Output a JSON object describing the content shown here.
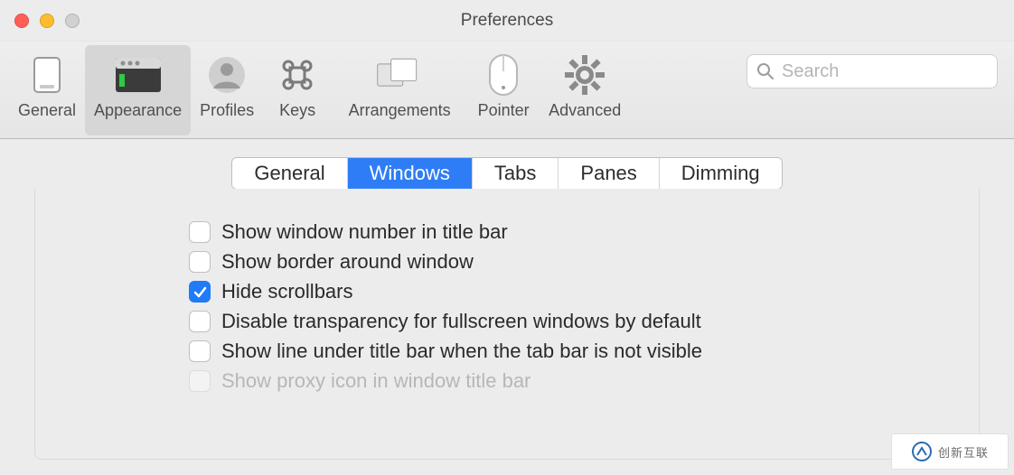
{
  "window": {
    "title": "Preferences"
  },
  "traffic": {
    "close": "close",
    "minimize": "minimize",
    "disabled": "zoom-disabled"
  },
  "toolbar": {
    "general": "General",
    "appearance": "Appearance",
    "profiles": "Profiles",
    "keys": "Keys",
    "arrangements": "Arrangements",
    "pointer": "Pointer",
    "advanced": "Advanced",
    "selected": "appearance"
  },
  "search": {
    "placeholder": "Search",
    "value": ""
  },
  "subtabs": {
    "items": [
      "General",
      "Windows",
      "Tabs",
      "Panes",
      "Dimming"
    ],
    "active": "Windows"
  },
  "options": [
    {
      "label": "Show window number in title bar",
      "checked": false,
      "enabled": true
    },
    {
      "label": "Show border around window",
      "checked": false,
      "enabled": true
    },
    {
      "label": "Hide scrollbars",
      "checked": true,
      "enabled": true
    },
    {
      "label": "Disable transparency for fullscreen windows by default",
      "checked": false,
      "enabled": true
    },
    {
      "label": "Show line under title bar when the tab bar is not visible",
      "checked": false,
      "enabled": true
    },
    {
      "label": "Show proxy icon in window title bar",
      "checked": false,
      "enabled": false
    }
  ],
  "badge": {
    "text": "创新互联"
  }
}
